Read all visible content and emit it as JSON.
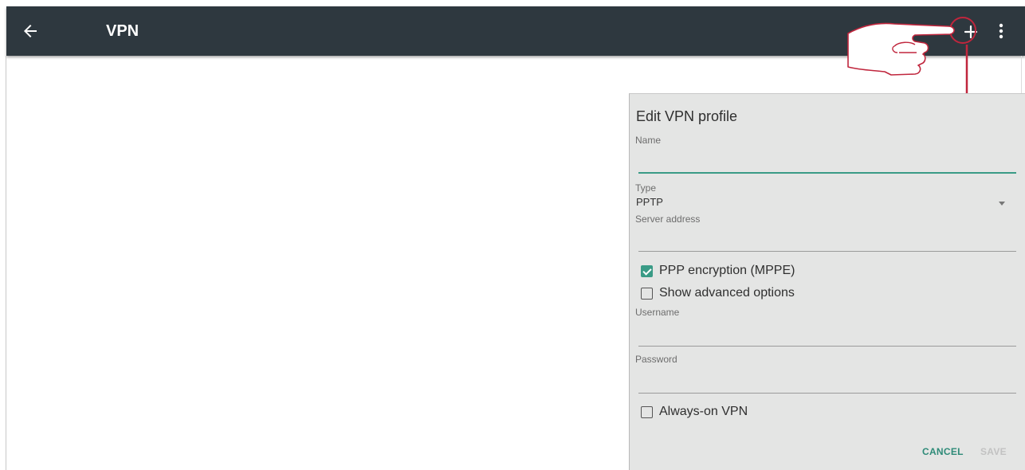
{
  "appbar": {
    "title": "VPN",
    "icons": {
      "back": "arrow-left-icon",
      "add": "plus-icon",
      "more": "more-vert-icon"
    }
  },
  "dialog": {
    "title": "Edit VPN profile",
    "name": {
      "label": "Name",
      "value": ""
    },
    "type": {
      "label": "Type",
      "value": "PPTP"
    },
    "server": {
      "label": "Server address",
      "value": ""
    },
    "ppp_encryption": {
      "label": "PPP encryption (MPPE)",
      "checked": true
    },
    "advanced": {
      "label": "Show advanced options",
      "checked": false
    },
    "username": {
      "label": "Username",
      "value": ""
    },
    "password": {
      "label": "Password",
      "value": ""
    },
    "always_on": {
      "label": "Always-on VPN",
      "checked": false
    },
    "cancel_label": "CANCEL",
    "save_label": "SAVE"
  },
  "colors": {
    "appbar": "#2e383f",
    "accent": "#3a9b86",
    "callout": "#c0263d",
    "dialog_bg": "#e4e5e4"
  }
}
